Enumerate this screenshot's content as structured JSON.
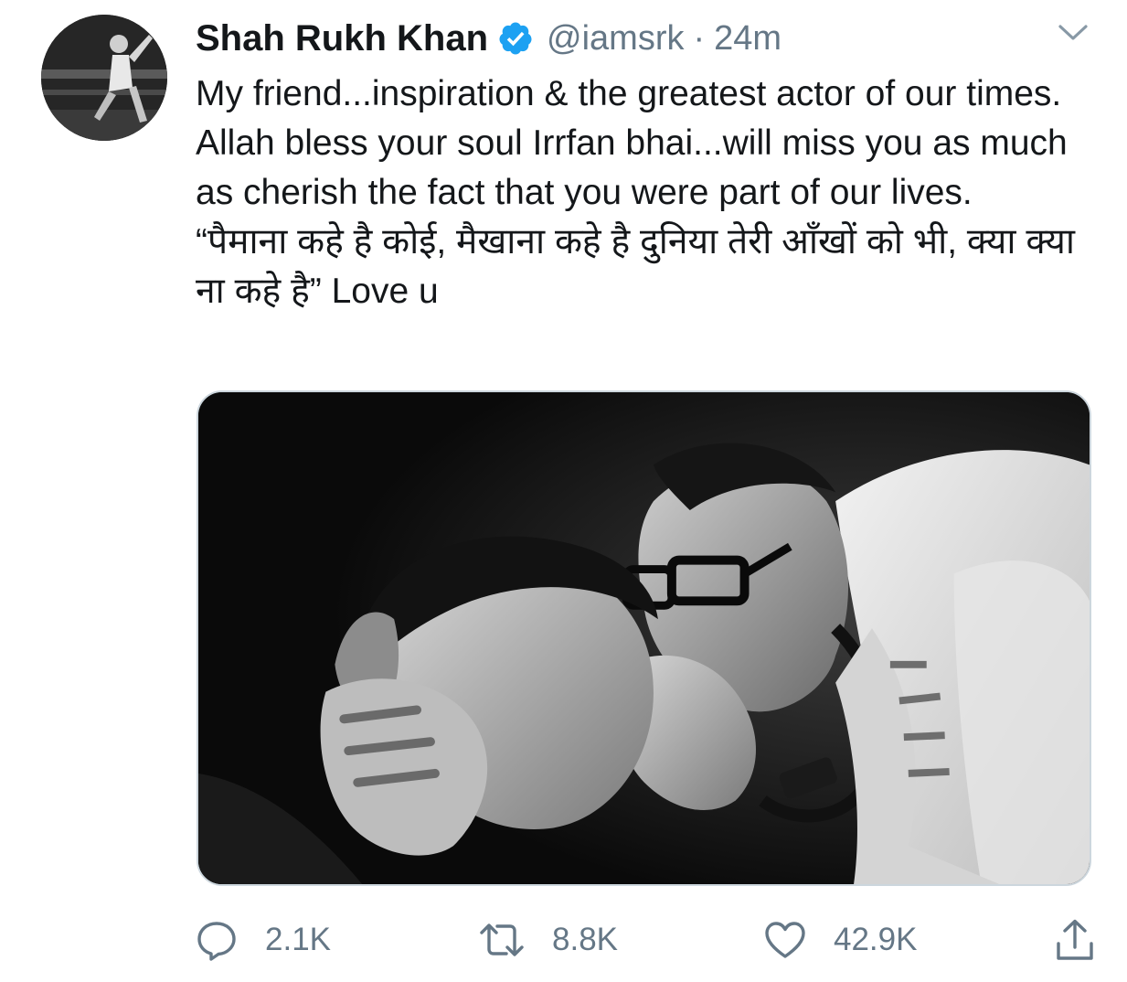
{
  "tweet": {
    "author": {
      "display_name": "Shah Rukh Khan",
      "handle": "@iamsrk",
      "verified": true,
      "avatar_icon": "profile-photo"
    },
    "separator": "·",
    "timestamp": "24m",
    "text": {
      "english": "My friend...inspiration & the greatest actor of our times. Allah bless your soul Irrfan bhai...will miss you as much as cherish the fact that you were part of our lives.",
      "hindi": "“पैमाना कहे है कोई, मैखाना कहे है  दुनिया तेरी आँखों को भी, क्या क्या ना कहे है” Love u"
    },
    "media": {
      "type": "photo",
      "style": "black-and-white"
    },
    "actions": {
      "reply_count": "2.1K",
      "retweet_count": "8.8K",
      "like_count": "42.9K"
    }
  },
  "colors": {
    "text_primary": "#14171a",
    "text_secondary": "#657786",
    "verified_badge": "#1da1f2",
    "media_border": "#ccd6dd"
  },
  "icons": {
    "menu": "chevron-down-icon",
    "verified": "verified-badge-icon",
    "reply": "reply-icon",
    "retweet": "retweet-icon",
    "like": "heart-icon",
    "share": "share-icon"
  }
}
